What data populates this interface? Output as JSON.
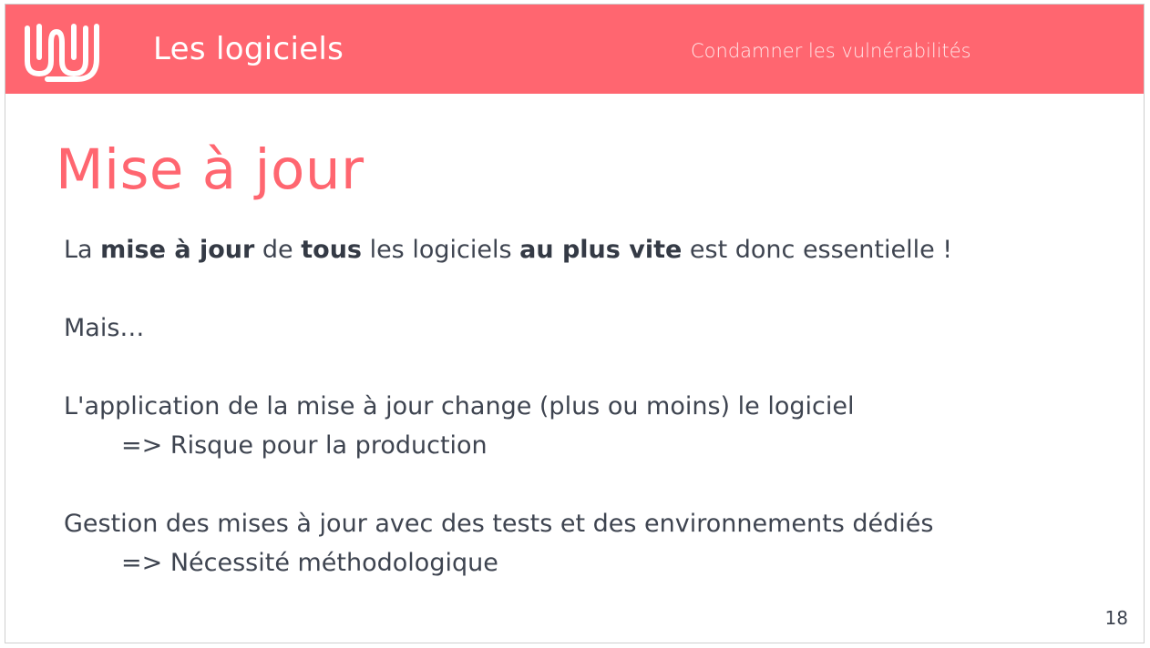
{
  "header": {
    "section_title": "Les logiciels",
    "subtitle": "Condamner les vulnérabilités",
    "logo_icon": "wave-logo-icon",
    "brand_color": "#ff6670"
  },
  "slide": {
    "title": "Mise à jour",
    "intro": {
      "p1": "La ",
      "b1": "mise à jour",
      "p2": " de ",
      "b2": "tous",
      "p3": " les logiciels ",
      "b3": "au plus vite",
      "p4": " est donc essentielle !"
    },
    "mais": "Mais…",
    "point1": {
      "text": "L'application de la mise à jour change (plus ou moins) le logiciel",
      "consequence": "=> Risque pour la production"
    },
    "point2": {
      "text": "Gestion des mises à jour avec des tests et des environnements dédiés",
      "consequence": "=> Nécessité méthodologique"
    },
    "page_number": "18"
  }
}
